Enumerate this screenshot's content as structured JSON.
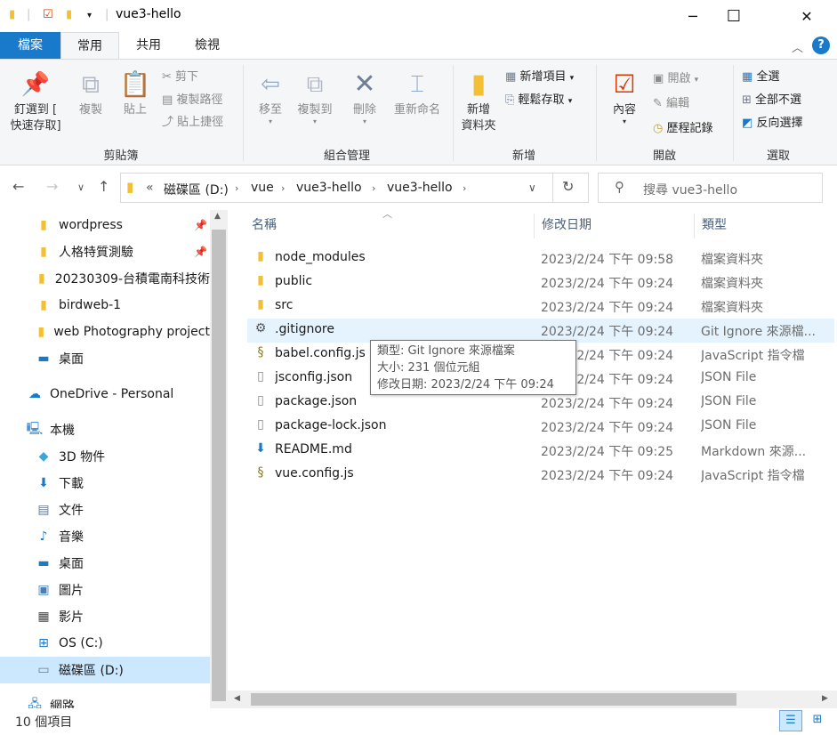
{
  "window": {
    "title": "vue3-hello",
    "minimize": "─",
    "maximize": "☐",
    "close": "✕"
  },
  "ribbon_tabs": [
    "檔案",
    "常用",
    "共用",
    "檢視"
  ],
  "ribbon": {
    "clipboard": {
      "label": "剪貼簿",
      "pin": "釘選到 [\n快速存取]",
      "copy": "複製",
      "paste": "貼上",
      "cut": "剪下",
      "copy_path": "複製路徑",
      "paste_shortcut": "貼上捷徑"
    },
    "organize": {
      "label": "組合管理",
      "move_to": "移至",
      "copy_to": "複製到",
      "delete": "刪除",
      "rename": "重新命名"
    },
    "new": {
      "label": "新增",
      "new_folder": "新增\n資料夾",
      "new_item": "新增項目",
      "easy_access": "輕鬆存取"
    },
    "open": {
      "label": "開啟",
      "properties": "內容",
      "open": "開啟",
      "edit": "編輯",
      "history": "歷程記錄"
    },
    "select": {
      "label": "選取",
      "select_all": "全選",
      "select_none": "全部不選",
      "invert": "反向選擇"
    }
  },
  "address": {
    "breadcrumbs": [
      "磁碟區 (D:)",
      "vue",
      "vue3-hello",
      "vue3-hello"
    ],
    "overflow": "«",
    "search_placeholder": "搜尋 vue3-hello"
  },
  "nav_pane": {
    "items": [
      {
        "label": "wordpress",
        "icon": "folder-icon",
        "pinned": true
      },
      {
        "label": "人格特質測驗",
        "icon": "folder-icon",
        "pinned": true
      },
      {
        "label": "20230309-台積電南科技術",
        "icon": "folder-icon",
        "pinned": false
      },
      {
        "label": "birdweb-1",
        "icon": "folder-icon",
        "pinned": false
      },
      {
        "label": "web Photography  project",
        "icon": "folder-icon",
        "pinned": false
      },
      {
        "label": "桌面",
        "icon": "desktop-icon",
        "pinned": false
      },
      {
        "label": "OneDrive - Personal",
        "icon": "cloud-icon",
        "pinned": false
      },
      {
        "label": "本機",
        "icon": "computer-icon",
        "pinned": false
      },
      {
        "label": "3D 物件",
        "icon": "cube-icon",
        "pinned": false
      },
      {
        "label": "下載",
        "icon": "download-icon",
        "pinned": false
      },
      {
        "label": "文件",
        "icon": "document-icon",
        "pinned": false
      },
      {
        "label": "音樂",
        "icon": "music-icon",
        "pinned": false
      },
      {
        "label": "桌面",
        "icon": "desktop-icon",
        "pinned": false
      },
      {
        "label": "圖片",
        "icon": "picture-icon",
        "pinned": false
      },
      {
        "label": "影片",
        "icon": "video-icon",
        "pinned": false
      },
      {
        "label": "OS (C:)",
        "icon": "drive-icon",
        "pinned": false
      },
      {
        "label": "磁碟區 (D:)",
        "icon": "drive-icon",
        "pinned": false,
        "selected": true
      },
      {
        "label": "網路",
        "icon": "network-icon",
        "pinned": false
      }
    ]
  },
  "columns": {
    "name": "名稱",
    "date": "修改日期",
    "type": "類型"
  },
  "files": [
    {
      "name": "node_modules",
      "date": "2023/2/24 下午 09:58",
      "type": "檔案資料夾",
      "icon": "folder-icon"
    },
    {
      "name": "public",
      "date": "2023/2/24 下午 09:24",
      "type": "檔案資料夾",
      "icon": "folder-icon"
    },
    {
      "name": "src",
      "date": "2023/2/24 下午 09:24",
      "type": "檔案資料夾",
      "icon": "folder-icon"
    },
    {
      "name": ".gitignore",
      "date": "2023/2/24 下午 09:24",
      "type": "Git Ignore 來源檔...",
      "icon": "gear-file-icon"
    },
    {
      "name": "babel.config.js",
      "date": "2023/2/24 下午 09:24",
      "type": "JavaScript 指令檔",
      "icon": "script-file-icon"
    },
    {
      "name": "jsconfig.json",
      "date": "2023/2/24 下午 09:24",
      "type": "JSON File",
      "icon": "blank-file-icon"
    },
    {
      "name": "package.json",
      "date": "2023/2/24 下午 09:24",
      "type": "JSON File",
      "icon": "blank-file-icon"
    },
    {
      "name": "package-lock.json",
      "date": "2023/2/24 下午 09:24",
      "type": "JSON File",
      "icon": "blank-file-icon"
    },
    {
      "name": "README.md",
      "date": "2023/2/24 下午 09:25",
      "type": "Markdown 來源...",
      "icon": "markdown-file-icon"
    },
    {
      "name": "vue.config.js",
      "date": "2023/2/24 下午 09:24",
      "type": "JavaScript 指令檔",
      "icon": "script-file-icon"
    }
  ],
  "tooltip": {
    "line1": "類型: Git Ignore 來源檔案",
    "line2": "大小: 231 個位元組",
    "line3": "修改日期: 2023/2/24 下午 09:24"
  },
  "status": {
    "item_count": "10 個項目"
  },
  "colors": {
    "accent": "#1979ca",
    "folder": "#f3c035",
    "selection": "#cce8ff",
    "hover": "#e5f3ff"
  }
}
